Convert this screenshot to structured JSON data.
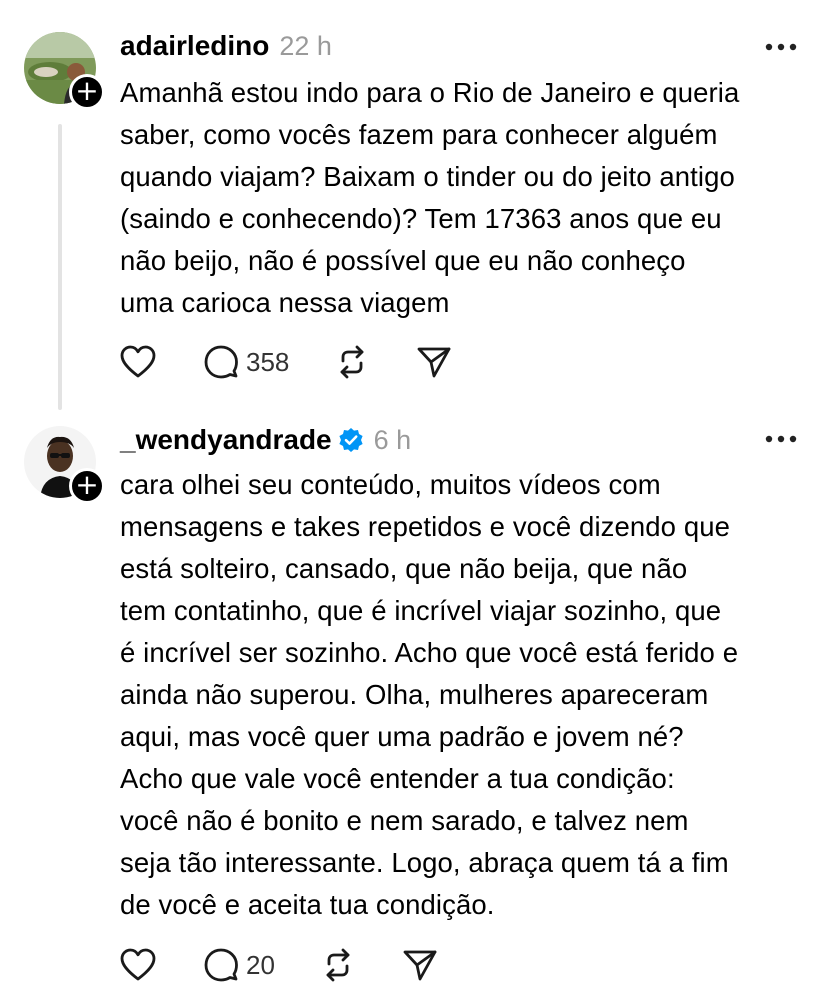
{
  "posts": [
    {
      "username": "adairledino",
      "verified": false,
      "timestamp": "22 h",
      "text": "Amanhã estou indo para o Rio de Janeiro e queria\nsaber, como vocês fazem para conhecer alguém\nquando viajam? Baixam o tinder ou do jeito antigo\n(saindo e conhecendo)? Tem 17363 anos que eu\nnão beijo, não é possível que eu não conheço\numa carioca nessa viagem",
      "reply_count": "358",
      "avatar_icon": "user-avatar-photo",
      "follow_icon": "plus-icon"
    },
    {
      "username": "_wendyandrade",
      "verified": true,
      "timestamp": "6 h",
      "text": "cara olhei seu conteúdo, muitos vídeos com\nmensagens e takes repetidos e você dizendo que\nestá solteiro, cansado, que não beija, que não\ntem contatinho, que é incrível viajar sozinho, que\né incrível ser sozinho. Acho que você está ferido e\nainda não superou. Olha, mulheres apareceram\naqui, mas você quer uma padrão e jovem né?\nAcho que vale você entender a tua condição:\nvocê não é bonito e nem sarado, e talvez nem\nseja tão interessante. Logo, abraça quem tá a fim\nde você e aceita tua condição.",
      "reply_count": "20",
      "avatar_icon": "user-avatar-photo",
      "follow_icon": "plus-icon"
    }
  ],
  "icons": {
    "like": "heart-icon",
    "reply": "comment-icon",
    "repost": "repost-icon",
    "share": "send-icon",
    "more": "more-icon",
    "verified": "verified-badge-icon"
  },
  "colors": {
    "text": "#000000",
    "muted": "#9a9a9a",
    "verified": "#0095f6",
    "thread_line": "#e3e3e3"
  }
}
